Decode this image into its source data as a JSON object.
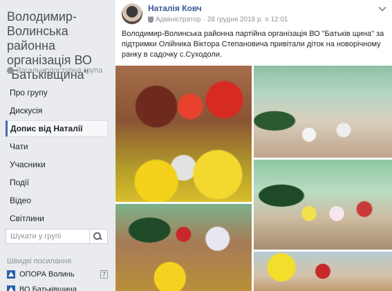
{
  "group": {
    "title": "Володимир-Волинська районна організація ВО \"Батьківщина\"",
    "privacy": "Загальнодоступна група"
  },
  "nav": {
    "items": [
      {
        "label": "Про групу"
      },
      {
        "label": "Дискусія"
      },
      {
        "label": "Допис від Наталії"
      },
      {
        "label": "Чати"
      },
      {
        "label": "Учасники"
      },
      {
        "label": "Події"
      },
      {
        "label": "Відео"
      },
      {
        "label": "Світлини"
      }
    ],
    "active_index": 2
  },
  "search": {
    "placeholder": "Шукати у групі"
  },
  "shortcuts": {
    "title": "Швидкі посилання",
    "items": [
      {
        "label": "ОПОРА Волинь",
        "badge": "7"
      },
      {
        "label": "ВО Батьківщина"
      }
    ]
  },
  "post": {
    "author": "Наталія Ковч",
    "role": "Адміністратор",
    "date": "28 грудня 2018 р. о 12:01",
    "text": "Володимир-Волинська районна партійна організація ВО \"Батьків щина\" за підтримки Олійника Віктора Степановича привітали діток на новорічному ранку в садочку с.Суходоли.",
    "photos": [
      "photo-1",
      "photo-2",
      "photo-3",
      "photo-4",
      "photo-5"
    ]
  },
  "colors": {
    "link": "#385898",
    "accent": "#4267b2",
    "page_bg": "#e9ebee"
  }
}
